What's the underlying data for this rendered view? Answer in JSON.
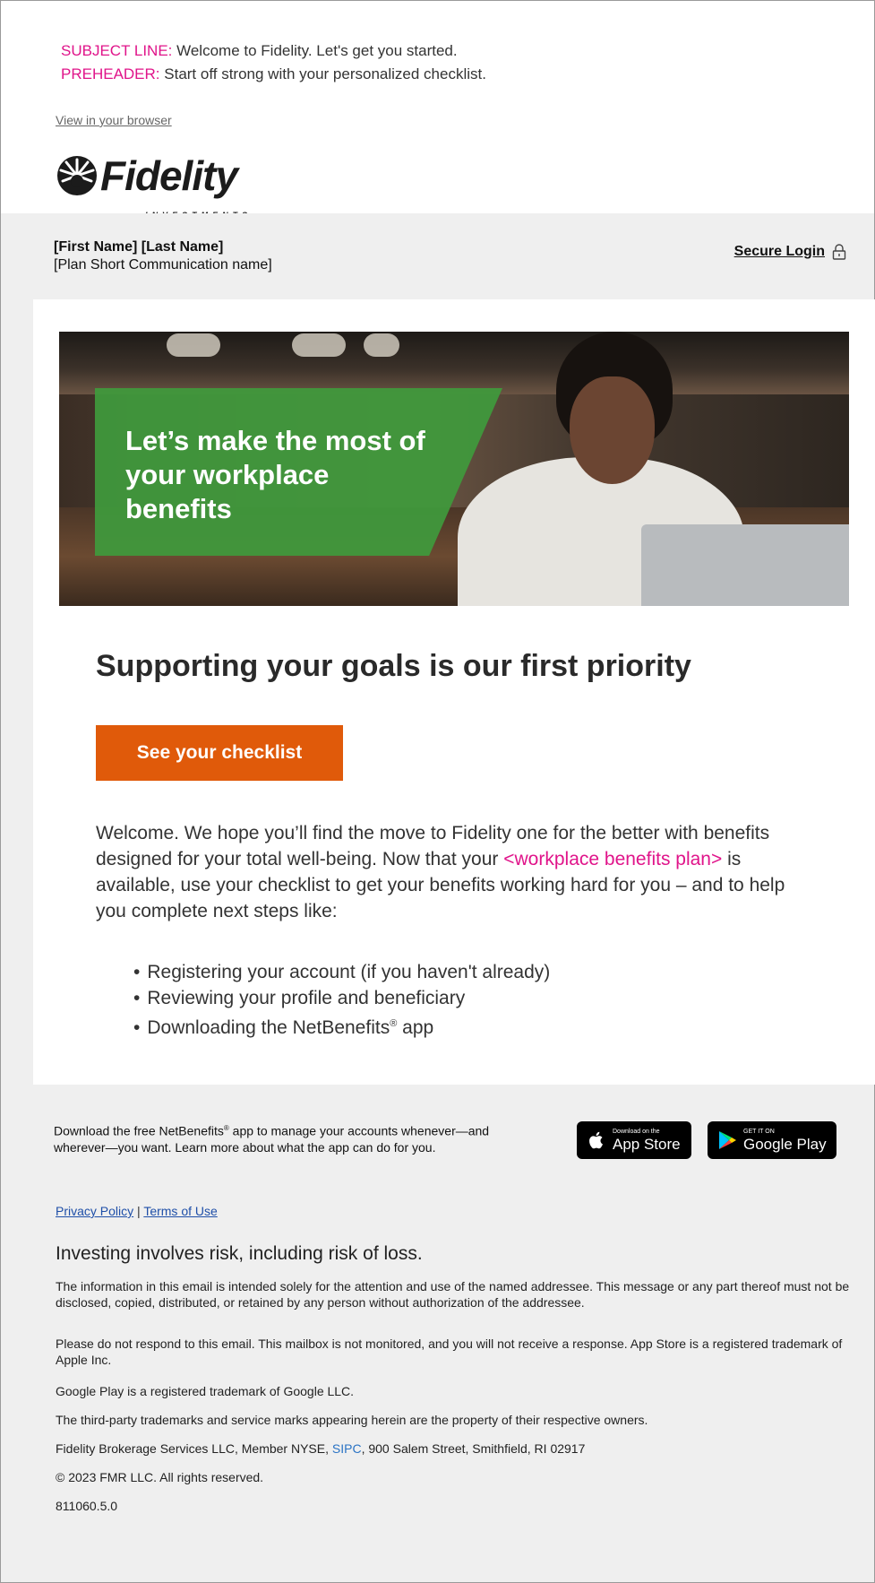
{
  "meta": {
    "subject_label": "SUBJECT LINE:",
    "subject_text": " Welcome to Fidelity. Let's get you started.",
    "preheader_label": "PREHEADER:",
    "preheader_text": " Start off strong with your personalized checklist."
  },
  "header": {
    "view_in_browser": "View in your browser",
    "logo_text": "Fidelity",
    "logo_sub": "INVESTMENTS",
    "recipient_name": "[First Name] [Last Name]",
    "plan_name": "[Plan Short Communication name]",
    "secure_login": "Secure Login"
  },
  "hero": {
    "banner_text": "Let’s make the most of your workplace benefits"
  },
  "main": {
    "headline": "Supporting your goals is our first priority",
    "cta_label": "See your checklist",
    "body_1": "Welcome. We hope you’ll find the move to Fidelity one for the better with benefits designed for your total well-being. Now that your ",
    "body_link": "<workplace benefits plan>",
    "body_2": " is available, use your checklist to get your benefits working hard for you – and to help you complete next steps like:",
    "bullets": [
      "Registering your account (if you haven't already)",
      "Reviewing your profile and beneficiary",
      "Downloading the NetBenefits"
    ],
    "bullet_3_suffix": " app",
    "registered_mark": "®"
  },
  "footer": {
    "app_promo_1": "Download the free NetBenefits",
    "app_promo_2": " app to manage your accounts whenever—and wherever—you want. Learn more about what the app can do for you.",
    "registered_mark": "®",
    "app_store_small": "Download on the",
    "app_store_big": "App Store",
    "google_small": "GET IT ON",
    "google_big": "Google Play",
    "privacy_policy": "Privacy Policy",
    "separator": " | ",
    "terms_of_use": "Terms of Use",
    "risk": "Investing involves risk, including risk of loss.",
    "fine_1": "The information in this email is intended solely for the attention and use of the named addressee. This message or any part thereof must not be disclosed, copied, distributed, or retained by any person without authorization of the addressee.",
    "fine_2": "Please do not respond to this email. This mailbox is not monitored, and you will not receive a response. App Store is a registered trademark of Apple Inc.",
    "fine_3": "Google Play is a registered trademark of Google LLC.",
    "fine_4": "The third-party trademarks and service marks appearing herein are the property of their respective owners.",
    "fine_5a": "Fidelity Brokerage Services LLC, Member NYSE, ",
    "fine_5_link": "SIPC",
    "fine_5b": ", 900 Salem Street, Smithfield, RI 02917",
    "copyright": "© 2023 FMR LLC. All rights reserved.",
    "code": "811060.5.0"
  },
  "colors": {
    "accent_pink": "#e0148a",
    "cta_orange": "#e05a0a",
    "banner_green": "#3f9a3c",
    "link_blue": "#1f4fa8"
  },
  "icons": [
    "fidelity-logo-icon",
    "lock-icon",
    "apple-icon",
    "google-play-icon"
  ]
}
